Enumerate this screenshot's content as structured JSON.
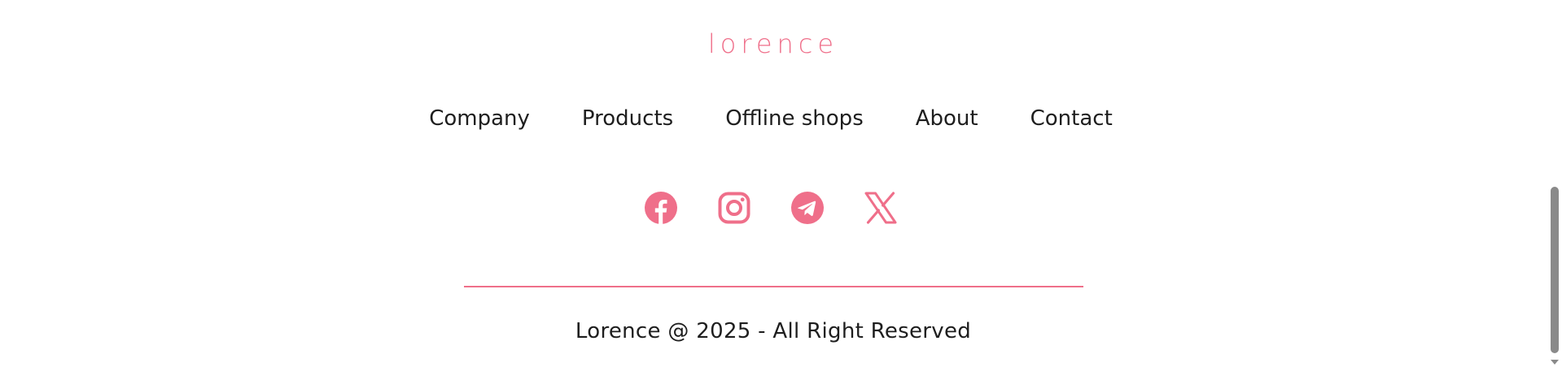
{
  "footer": {
    "logo_text": "lorence",
    "nav": [
      {
        "label": "Company"
      },
      {
        "label": "Products"
      },
      {
        "label": "Offline shops"
      },
      {
        "label": "About"
      },
      {
        "label": "Contact"
      }
    ],
    "social": [
      "facebook-icon",
      "instagram-icon",
      "telegram-icon",
      "x-icon"
    ],
    "copyright": "Lorence @ 2025 - All Right Reserved"
  },
  "colors": {
    "accent": "#ef6f8a",
    "text": "#1e1e1e",
    "background": "#ffffff",
    "scrollbar": "#8a8a8a"
  }
}
